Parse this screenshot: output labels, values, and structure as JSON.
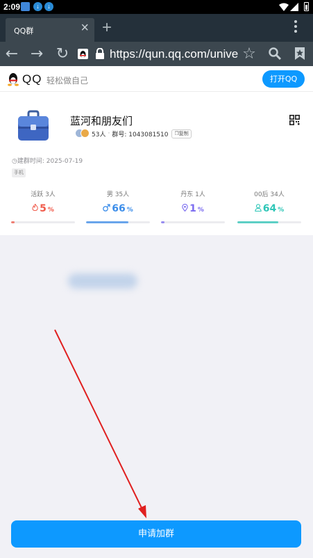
{
  "status_bar": {
    "time": "2:09"
  },
  "browser": {
    "tab_title": "QQ群",
    "tab_close": "×",
    "new_tab": "+",
    "url": "https://qun.qq.com/universal-share"
  },
  "page": {
    "brand": "QQ",
    "slogan": "轻松做自己",
    "open_button": "打开QQ",
    "group": {
      "name": "蓝河和朋友们",
      "member_count": "53人",
      "separator": "·",
      "group_number": "群号: 1043081510",
      "copy_label": "复制",
      "build_time": "建群时间: 2025-07-19",
      "tag": "手机"
    },
    "stats": [
      {
        "label": "活跃 3人",
        "icon": "flame-icon",
        "value": "5",
        "pct": "%",
        "fill": 0.05,
        "color": "#f05a4a"
      },
      {
        "label": "男 35人",
        "icon": "male-icon",
        "value": "66",
        "pct": "%",
        "fill": 0.66,
        "color": "#3d8eea"
      },
      {
        "label": "丹东 1人",
        "icon": "location-icon",
        "value": "1",
        "pct": "%",
        "fill": 0.01,
        "color": "#7b6cf0"
      },
      {
        "label": "00后 34人",
        "icon": "person-icon",
        "value": "64",
        "pct": "%",
        "fill": 0.64,
        "color": "#2ec6b7"
      }
    ],
    "apply_button": "申请加群"
  },
  "colors": {
    "accent": "#0d99ff",
    "annotation_arrow": "#e02020"
  }
}
